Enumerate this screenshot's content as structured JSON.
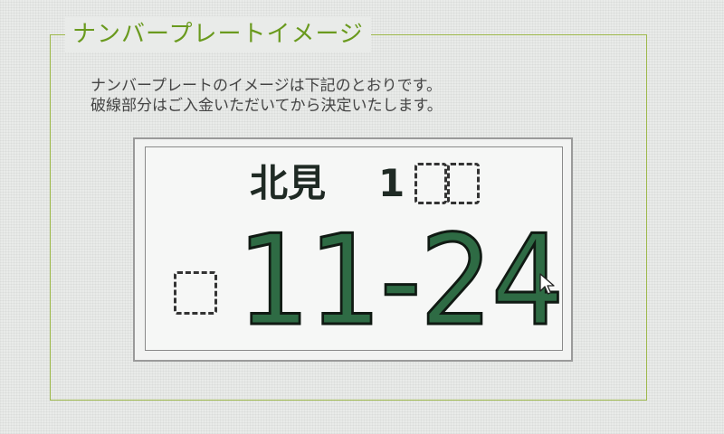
{
  "section": {
    "title": "ナンバープレートイメージ"
  },
  "description": {
    "line1": "ナンバープレートのイメージは下記のとおりです。",
    "line2": "破線部分はご入金いただいてから決定いたします。"
  },
  "plate": {
    "region": "北見",
    "class_digit": "1",
    "number": "11-24"
  },
  "colors": {
    "accent": "#6a9a1e",
    "plate_number": "#2e6b44"
  },
  "icons": {
    "cursor": "mouse-pointer-icon"
  }
}
